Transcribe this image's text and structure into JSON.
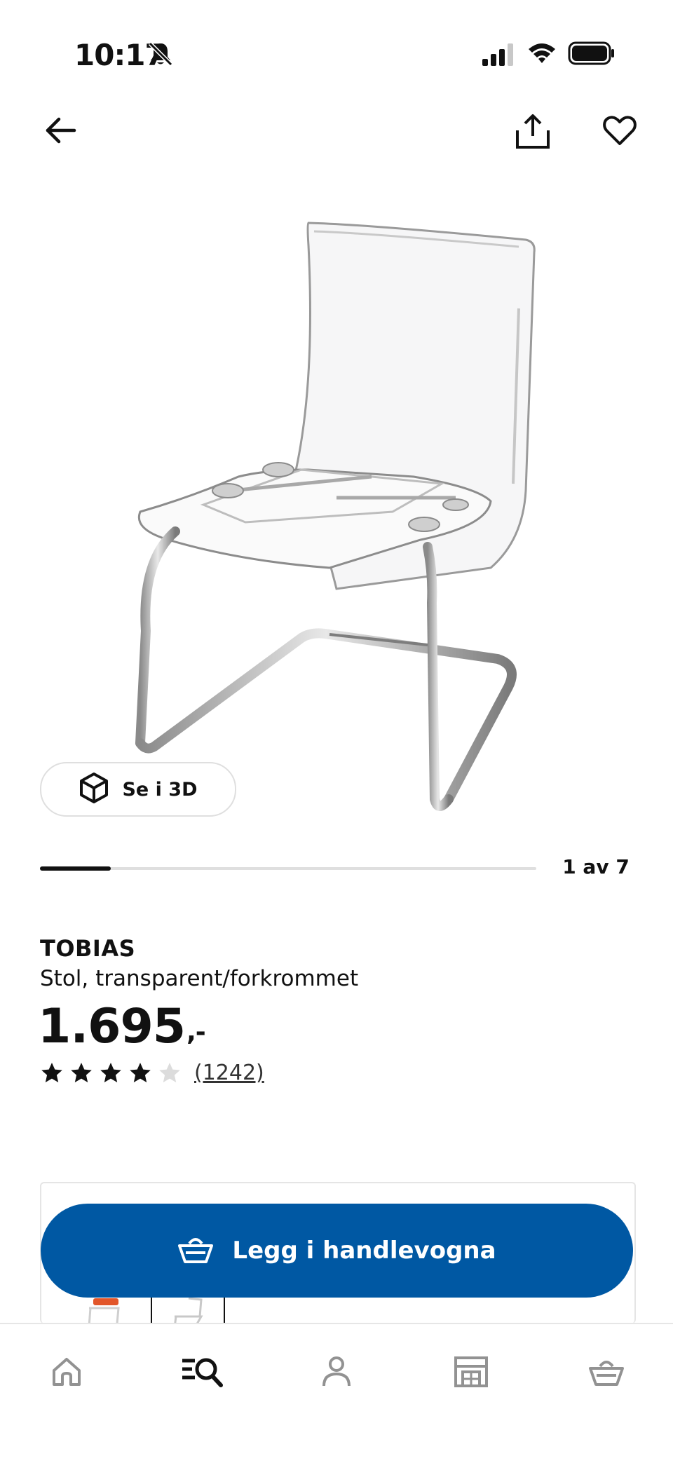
{
  "status_bar": {
    "time": "10:17",
    "icons": [
      "bell-muted-icon",
      "signal-icon",
      "wifi-icon",
      "battery-icon"
    ]
  },
  "nav": {
    "icons": [
      "back-arrow-icon",
      "share-icon",
      "heart-icon"
    ]
  },
  "gallery": {
    "view3d_label": "Se i 3D",
    "counter": "1 av 7",
    "progress": 0.142857
  },
  "product": {
    "name": "TOBIAS",
    "description": "Stol, transparent/forkrommet",
    "price": "1.695",
    "price_suffix": ",-",
    "rating": 4,
    "rating_max": 5,
    "review_count": "(1242)"
  },
  "cart": {
    "label": "Legg i handlevogna",
    "icon": "basket-icon"
  },
  "tab_bar": {
    "items": [
      "home-icon",
      "search-icon",
      "profile-icon",
      "store-icon",
      "basket-icon"
    ],
    "active": "search-icon"
  },
  "colors": {
    "primary": "#0058a3",
    "text": "#111111",
    "star_filled": "#111111",
    "star_empty": "#dcdcdc",
    "track": "#dfdfdf",
    "tab_icon": "#929292"
  }
}
